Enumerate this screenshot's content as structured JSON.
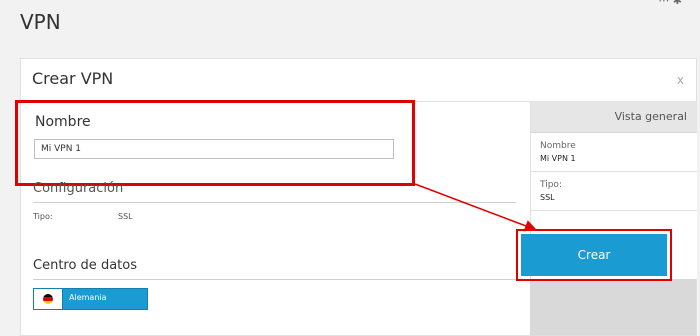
{
  "page": {
    "title": "VPN"
  },
  "dialog": {
    "title": "Crear VPN",
    "close_label": "x"
  },
  "form": {
    "name_label": "Nombre",
    "name_value": "Mi VPN 1",
    "config_label": "Configuración",
    "type_label": "Tipo:",
    "type_value": "SSL",
    "datacenter_label": "Centro de datos",
    "datacenter_value": "Alemania"
  },
  "sidebar": {
    "heading": "Vista general",
    "name_label": "Nombre",
    "name_value": "Mi VPN 1",
    "type_label": "Tipo:",
    "type_value": "SSL"
  },
  "actions": {
    "create_label": "Crear"
  },
  "colors": {
    "accent": "#1a9bd1",
    "highlight": "#e00000"
  },
  "icons": {
    "flag": "germany-flag-icon",
    "arrow": "arrow-annotation"
  }
}
